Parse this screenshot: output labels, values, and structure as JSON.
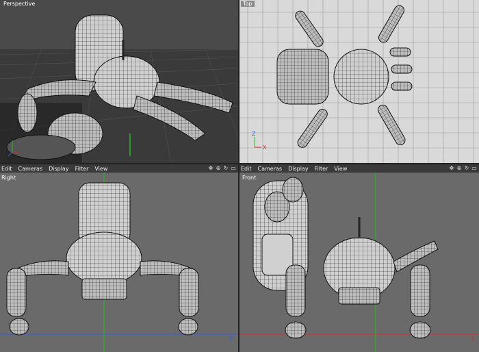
{
  "viewports": {
    "perspective": {
      "title": "Perspective"
    },
    "top": {
      "title": "Top"
    },
    "right": {
      "title": "Right"
    },
    "front": {
      "title": "Front"
    }
  },
  "menu": [
    "Edit",
    "Cameras",
    "Display",
    "Filter",
    "View"
  ],
  "axes": {
    "x": "X",
    "y": "Y",
    "z": "Z"
  },
  "icons": [
    "move-view-icon",
    "zoom-view-icon",
    "rotate-view-icon",
    "maximize-view-icon"
  ],
  "colors": {
    "axis_x": "#d03030",
    "axis_y": "#20c020",
    "axis_z": "#3060e0",
    "grid_top_bg": "#d9d9d9",
    "viewport_bg": "#6a6a6a"
  }
}
